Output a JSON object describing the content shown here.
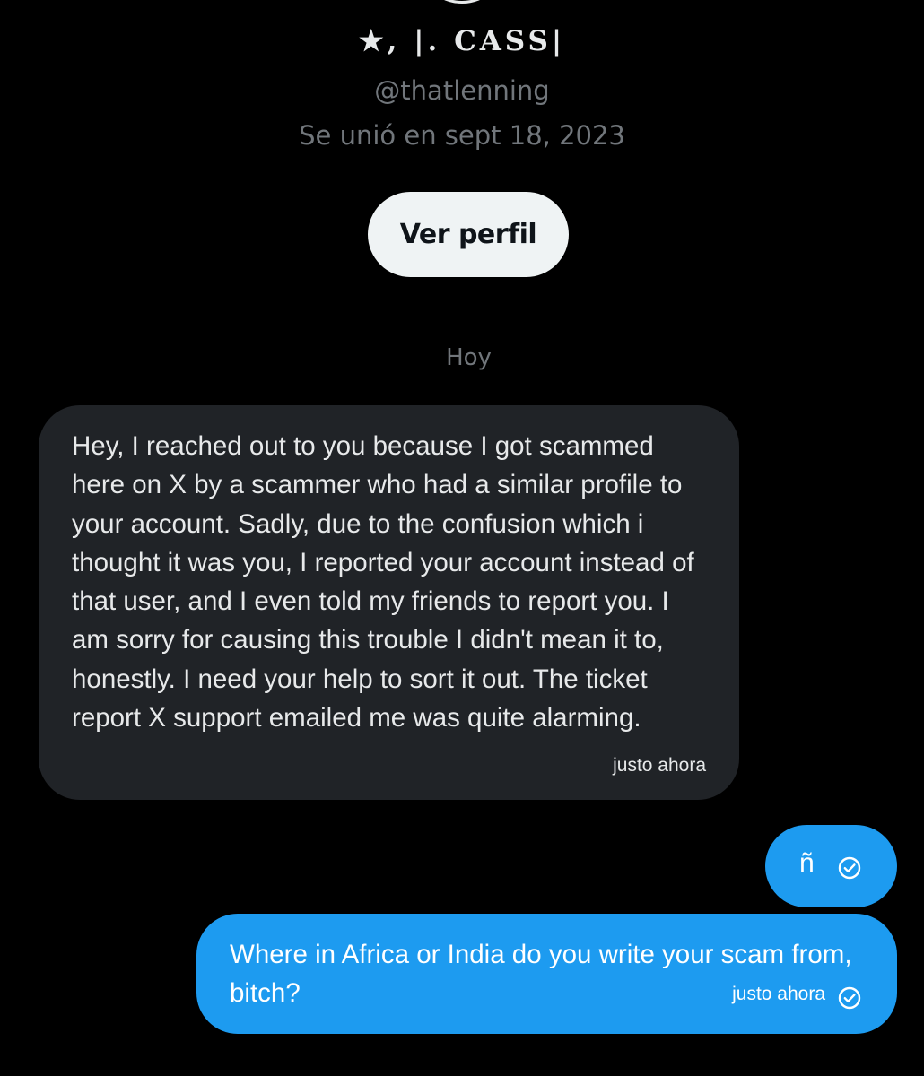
{
  "profile": {
    "display_name": "★, |. CASS|",
    "handle": "@thatlenning",
    "joined": "Se unió en sept 18, 2023",
    "view_profile_label": "Ver perfil"
  },
  "conversation": {
    "date_divider": "Hoy",
    "messages": [
      {
        "direction": "incoming",
        "text": "Hey, I reached out to you because I got scammed here on X by a scammer who had a similar profile to your account. Sadly, due to the confusion which i thought it was you, I reported your account instead of that user, and I even told my friends to report you. I am sorry for causing this trouble I didn't mean it to, honestly. I need your help to sort it out. The ticket report X support emailed me was quite alarming.",
        "time": "justo ahora"
      },
      {
        "direction": "outgoing",
        "text": "ñ",
        "status_icon": "check-circle-icon"
      },
      {
        "direction": "outgoing",
        "text": "Where in Africa or India do you write your scam from, bitch?",
        "time": "justo ahora",
        "status_icon": "check-circle-icon"
      }
    ]
  },
  "colors": {
    "background": "#000000",
    "incoming_bubble": "#202327",
    "outgoing_bubble": "#1d9bf0",
    "secondary_text": "#71767b",
    "primary_text": "#e7e9ea",
    "button_bg": "#eff3f4"
  }
}
